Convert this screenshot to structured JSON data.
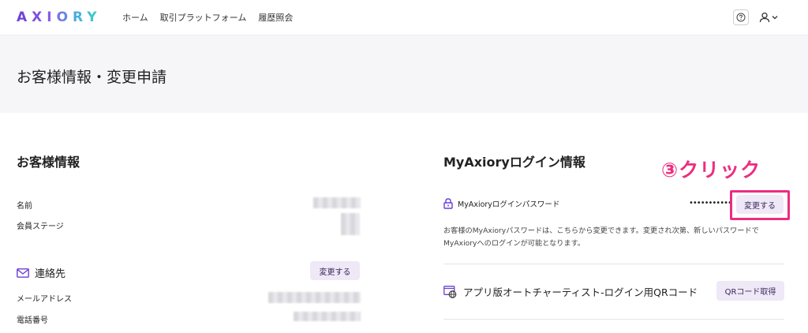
{
  "header": {
    "logo": "AXIORY",
    "nav": [
      "ホーム",
      "取引プラットフォーム",
      "履歴照会"
    ],
    "help_icon": "question-icon",
    "user_icon": "user-icon"
  },
  "page": {
    "title": "お客様情報・変更申請"
  },
  "customer": {
    "section_title": "お客様情報",
    "name_label": "名前",
    "stage_label": "会員ステージ",
    "contact_title": "連絡先",
    "contact_change_button": "変更する",
    "email_label": "メールアドレス",
    "phone_label": "電話番号"
  },
  "login": {
    "section_title": "MyAxioryログイン情報",
    "password_label": "MyAxioryログインパスワード",
    "password_value": "•••••••••••",
    "change_button": "変更する",
    "note": "お客様のMyAxioryパスワードは、こちらから変更できます。変更され次第、新しいパスワードでMyAxioryへのログインが可能となります。",
    "qr_label": "アプリ版オートチャーティスト-ログイン用QRコード",
    "qr_button": "QRコード取得"
  },
  "annotation": {
    "callout": "③クリック",
    "color": "#ec2d80"
  },
  "colors": {
    "accent": "#6a3fd6",
    "button_bg": "#efe8f7",
    "title_band": "#f6f6f8"
  }
}
